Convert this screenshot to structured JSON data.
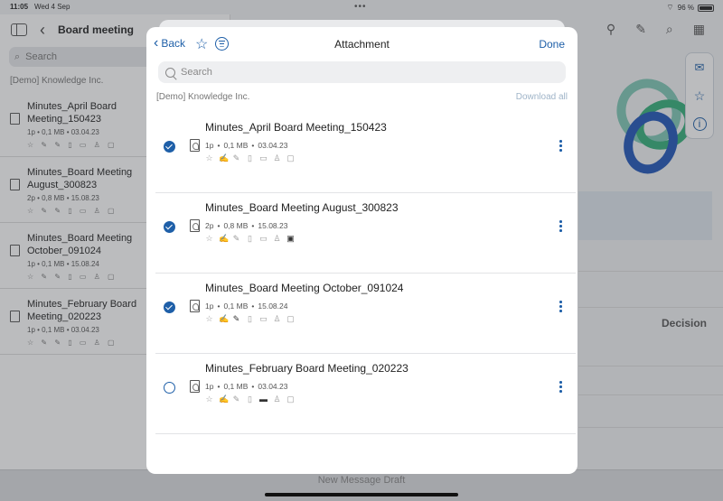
{
  "status_bar": {
    "time": "11:05",
    "date": "Wed 4 Sep",
    "battery": "96 %"
  },
  "background": {
    "sidebar_title": "Board meeting",
    "search_placeholder": "Search",
    "org": "[Demo] Knowledge Inc.",
    "items": [
      {
        "title": "Minutes_April Board Meeting_150423",
        "meta": "1p • 0,1 MB • 03.04.23"
      },
      {
        "title": "Minutes_Board Meeting August_300823",
        "meta": "2p • 0,8 MB • 15.08.23"
      },
      {
        "title": "Minutes_Board Meeting October_091024",
        "meta": "1p • 0,1 MB • 15.08.24"
      },
      {
        "title": "Minutes_February Board Meeting_020223",
        "meta": "1p • 0,1 MB • 03.04.23"
      }
    ],
    "decision_label": "Decision",
    "bottom_draft": "New Message Draft"
  },
  "sheet": {
    "back_label": "Back",
    "title": "Attachment",
    "done_label": "Done",
    "search_placeholder": "Search",
    "org": "[Demo] Knowledge Inc.",
    "download_all": "Download all",
    "items": [
      {
        "title": "Minutes_April Board Meeting_150423",
        "pages": "1p",
        "size": "0,1 MB",
        "date": "03.04.23",
        "checked": true,
        "active_icons": []
      },
      {
        "title": "Minutes_Board Meeting August_300823",
        "pages": "2p",
        "size": "0,8 MB",
        "date": "15.08.23",
        "checked": true,
        "active_icons": [
          "sign",
          "lock"
        ]
      },
      {
        "title": "Minutes_Board Meeting October_091024",
        "pages": "1p",
        "size": "0,1 MB",
        "date": "15.08.24",
        "checked": true,
        "active_icons": [
          "pen"
        ]
      },
      {
        "title": "Minutes_February Board Meeting_020223",
        "pages": "1p",
        "size": "0,1 MB",
        "date": "03.04.23",
        "checked": false,
        "active_icons": [
          "comment"
        ]
      }
    ]
  },
  "colors": {
    "accent": "#1e5fa8",
    "download_all": "#9fb4c8"
  },
  "icons": [
    "star-icon",
    "sign-icon",
    "pen-icon",
    "doc-icon",
    "comment-icon",
    "thumbs-up-icon",
    "lock-icon"
  ]
}
